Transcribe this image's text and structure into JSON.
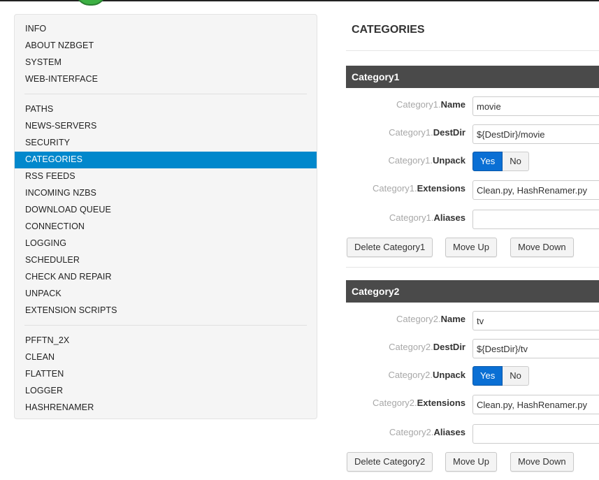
{
  "sidebar": {
    "groups": [
      [
        "INFO",
        "ABOUT NZBGET",
        "SYSTEM",
        "WEB-INTERFACE"
      ],
      [
        "PATHS",
        "NEWS-SERVERS",
        "SECURITY",
        "CATEGORIES",
        "RSS FEEDS",
        "INCOMING NZBS",
        "DOWNLOAD QUEUE",
        "CONNECTION",
        "LOGGING",
        "SCHEDULER",
        "CHECK AND REPAIR",
        "UNPACK",
        "EXTENSION SCRIPTS"
      ],
      [
        "PFFTN_2X",
        "CLEAN",
        "FLATTEN",
        "LOGGER",
        "HASHRENAMER"
      ]
    ],
    "active": "CATEGORIES"
  },
  "main": {
    "title": "CATEGORIES",
    "categories": [
      {
        "header": "Category1",
        "prefix": "Category1.",
        "fields": {
          "name": "Name",
          "destdir": "DestDir",
          "unpack": "Unpack",
          "extensions": "Extensions",
          "aliases": "Aliases"
        },
        "values": {
          "name": "movie",
          "destdir": "${DestDir}/movie",
          "extensions": "Clean.py, HashRenamer.py",
          "aliases": ""
        },
        "unpack": {
          "yes": "Yes",
          "no": "No",
          "selected": "Yes"
        },
        "buttons": {
          "delete": "Delete Category1",
          "move_up": "Move Up",
          "move_down": "Move Down"
        }
      },
      {
        "header": "Category2",
        "prefix": "Category2.",
        "fields": {
          "name": "Name",
          "destdir": "DestDir",
          "unpack": "Unpack",
          "extensions": "Extensions",
          "aliases": "Aliases"
        },
        "values": {
          "name": "tv",
          "destdir": "${DestDir}/tv",
          "extensions": "Clean.py, HashRenamer.py",
          "aliases": ""
        },
        "unpack": {
          "yes": "Yes",
          "no": "No",
          "selected": "Yes"
        },
        "buttons": {
          "delete": "Delete Category2",
          "move_up": "Move Up",
          "move_down": "Move Down"
        }
      }
    ]
  },
  "colors": {
    "active_nav": "#0288cc",
    "header_bg": "#4a4a4a",
    "toggle_on": "#0a6fd4"
  }
}
